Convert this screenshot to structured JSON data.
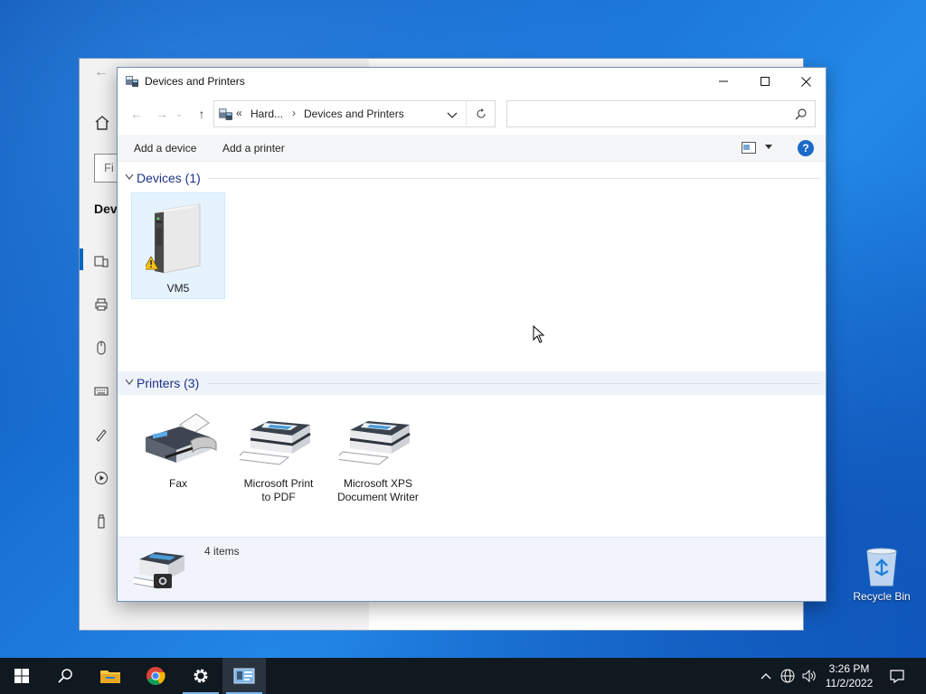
{
  "window": {
    "title": "Devices and Printers",
    "minimize_label": "Minimize",
    "maximize_label": "Maximize",
    "close_label": "Close"
  },
  "address": {
    "chevron": "«",
    "segment1": "Hard...",
    "separator": "›",
    "segment2": "Devices and Printers"
  },
  "search": {
    "placeholder": ""
  },
  "commands": {
    "add_device": "Add a device",
    "add_printer": "Add a printer",
    "help": "?"
  },
  "groups": {
    "devices": {
      "label": "Devices (1)",
      "items": [
        {
          "label": "VM5"
        }
      ]
    },
    "printers": {
      "label": "Printers (3)",
      "items": [
        {
          "label_line1": "Fax",
          "label_line2": ""
        },
        {
          "label_line1": "Microsoft Print",
          "label_line2": "to PDF"
        },
        {
          "label_line1": "Microsoft XPS",
          "label_line2": "Document Writer"
        }
      ]
    }
  },
  "details": {
    "text": "4 items"
  },
  "settings_background": {
    "search_fragment": "Fi",
    "heading_fragment": "Dev"
  },
  "desktop": {
    "recycle_bin": "Recycle Bin"
  },
  "taskbar": {
    "time": "3:26 PM",
    "date": "11/2/2022",
    "buttons": [
      "start-icon",
      "search-icon",
      "file-explorer-icon",
      "chrome-icon",
      "settings-icon",
      "devices-printers-icon"
    ]
  },
  "colors": {
    "accent": "#0067c0",
    "group_header": "#1e3287",
    "selection": "#e5f3ff",
    "help_badge": "#1b6ac9"
  }
}
